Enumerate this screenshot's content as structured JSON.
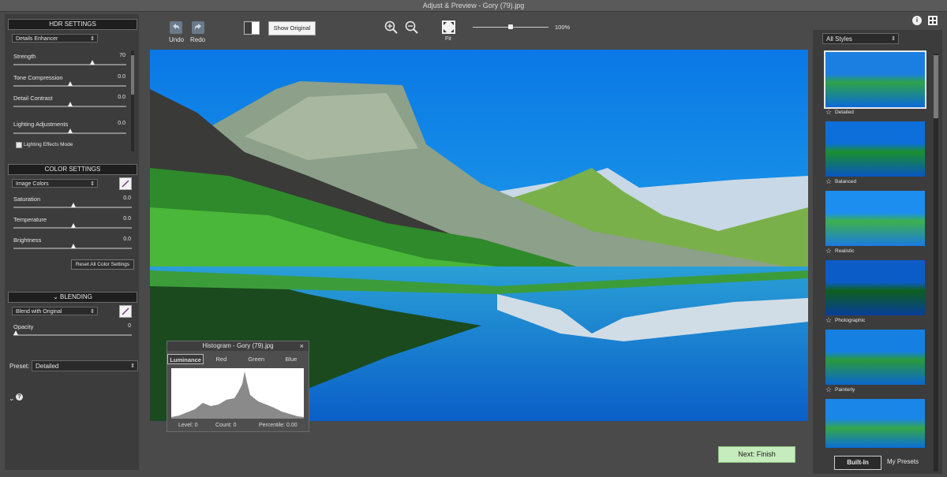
{
  "window": {
    "title": "Adjust & Preview - Gory (79).jpg"
  },
  "hdr": {
    "header": "HDR SETTINGS",
    "preset": "Details Enhancer",
    "sliders": [
      {
        "label": "Strength",
        "value": "70"
      },
      {
        "label": "Tone Compression",
        "value": "0.0"
      },
      {
        "label": "Detail Contrast",
        "value": "0.0"
      },
      {
        "label": "Lighting Adjustments",
        "value": "0.0"
      }
    ],
    "checkbox_label": "Lighting Effects Mode"
  },
  "color": {
    "header": "COLOR SETTINGS",
    "mode": "Image Colors",
    "sliders": [
      {
        "label": "Saturation",
        "value": "0.0"
      },
      {
        "label": "Temperature",
        "value": "0.0"
      },
      {
        "label": "Brightness",
        "value": "0.0"
      }
    ],
    "reset_label": "Reset All Color Settings"
  },
  "blending": {
    "header": "BLENDING",
    "mode": "Blend with Original",
    "opacity_label": "Opacity",
    "opacity_value": "0"
  },
  "preset": {
    "label": "Preset:",
    "value": "Detailed"
  },
  "toolbar": {
    "undo": "Undo",
    "redo": "Redo",
    "show_original": "Show Original",
    "fit": "Fit",
    "zoom": "100%"
  },
  "styles": {
    "dropdown": "All Styles",
    "items": [
      "Detailed",
      "Balanced",
      "Realistic",
      "Photographic",
      "Painterly"
    ],
    "tabs": [
      "Built-In",
      "My Presets"
    ]
  },
  "histogram": {
    "title": "Histogram - Gory (79).jpg",
    "tabs": [
      "Luminance",
      "Red",
      "Green",
      "Blue"
    ],
    "level": "Level: 0",
    "count": "Count: 0",
    "percentile": "Percentile: 0.00"
  },
  "footer": {
    "next": "Next: Finish"
  }
}
